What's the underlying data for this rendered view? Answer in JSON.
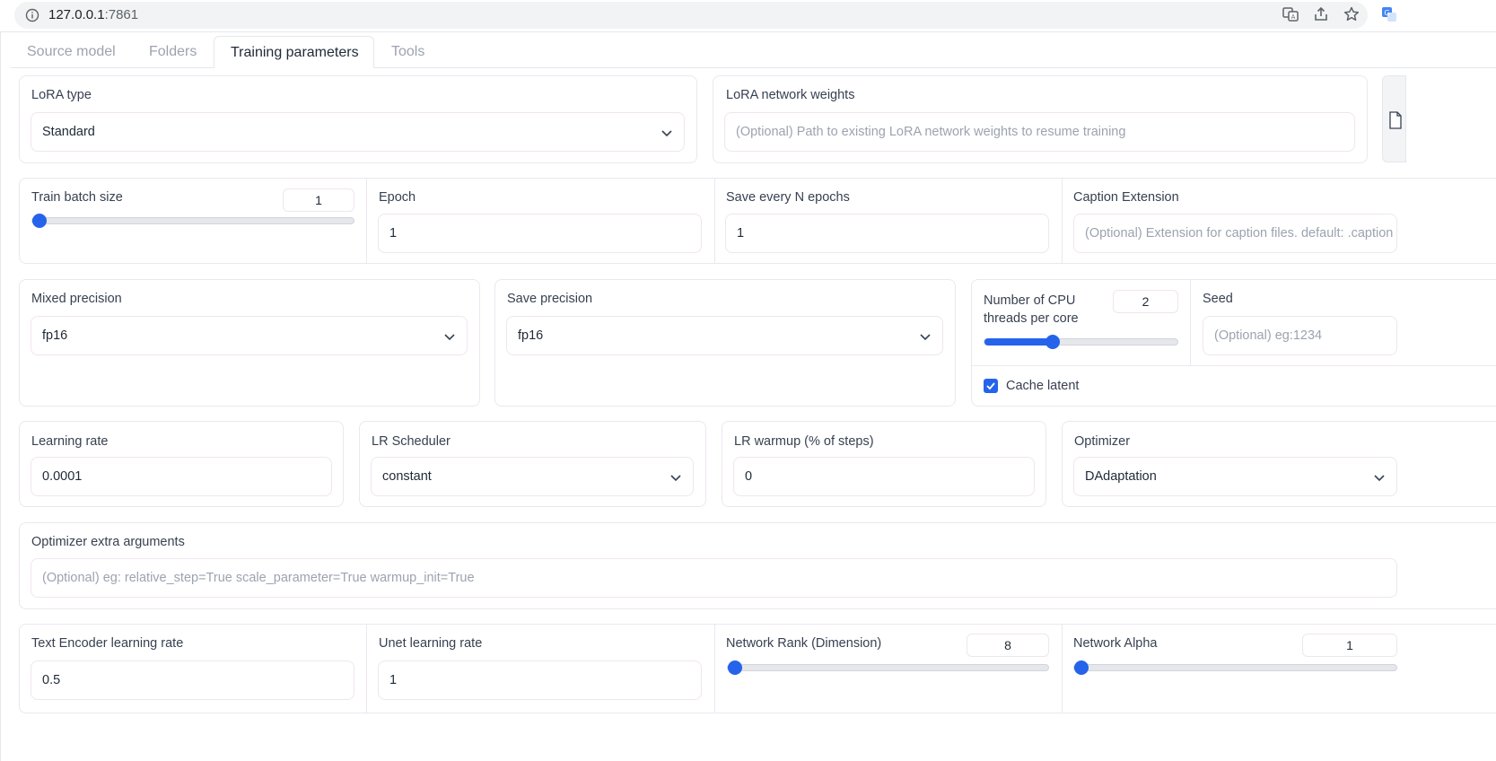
{
  "browser": {
    "url_host": "127.0.0.1",
    "url_port": ":7861"
  },
  "tabs": [
    {
      "label": "Source model"
    },
    {
      "label": "Folders"
    },
    {
      "label": "Training parameters"
    },
    {
      "label": "Tools"
    }
  ],
  "lora_type": {
    "label": "LoRA type",
    "value": "Standard"
  },
  "lora_weights": {
    "label": "LoRA network weights",
    "placeholder": "(Optional) Path to existing LoRA network weights to resume training"
  },
  "train_batch_size": {
    "label": "Train batch size",
    "value": "1",
    "fraction": 0.0
  },
  "epoch": {
    "label": "Epoch",
    "value": "1"
  },
  "save_every": {
    "label": "Save every N epochs",
    "value": "1"
  },
  "caption_ext": {
    "label": "Caption Extension",
    "placeholder": "(Optional) Extension for caption files. default: .caption"
  },
  "mixed_precision": {
    "label": "Mixed precision",
    "value": "fp16"
  },
  "save_precision": {
    "label": "Save precision",
    "value": "fp16"
  },
  "cpu_threads": {
    "label_line1": "Number of CPU",
    "label_line2": "threads per core",
    "value": "2",
    "fraction": 0.35
  },
  "seed": {
    "label": "Seed",
    "placeholder": "(Optional) eg:1234"
  },
  "cache_latent": {
    "label": "Cache latent",
    "checked": true
  },
  "learning_rate": {
    "label": "Learning rate",
    "value": "0.0001"
  },
  "lr_scheduler": {
    "label": "LR Scheduler",
    "value": "constant"
  },
  "lr_warmup": {
    "label": "LR warmup (% of steps)",
    "value": "0"
  },
  "optimizer": {
    "label": "Optimizer",
    "value": "DAdaptation"
  },
  "optimizer_args": {
    "label": "Optimizer extra arguments",
    "placeholder": "(Optional) eg: relative_step=True scale_parameter=True warmup_init=True"
  },
  "text_encoder_lr": {
    "label": "Text Encoder learning rate",
    "value": "0.5"
  },
  "unet_lr": {
    "label": "Unet learning rate",
    "value": "1"
  },
  "network_rank": {
    "label": "Network Rank (Dimension)",
    "value": "8",
    "fraction": 0.0
  },
  "network_alpha": {
    "label": "Network Alpha",
    "value": "1",
    "fraction": 0.0
  },
  "colors": {
    "accent": "#2563eb",
    "border": "#ece7ef"
  },
  "icons": [
    "info-icon",
    "translate-icon",
    "share-icon",
    "star-icon",
    "extension-icon",
    "chevron-down-icon",
    "file-icon",
    "check-icon"
  ]
}
